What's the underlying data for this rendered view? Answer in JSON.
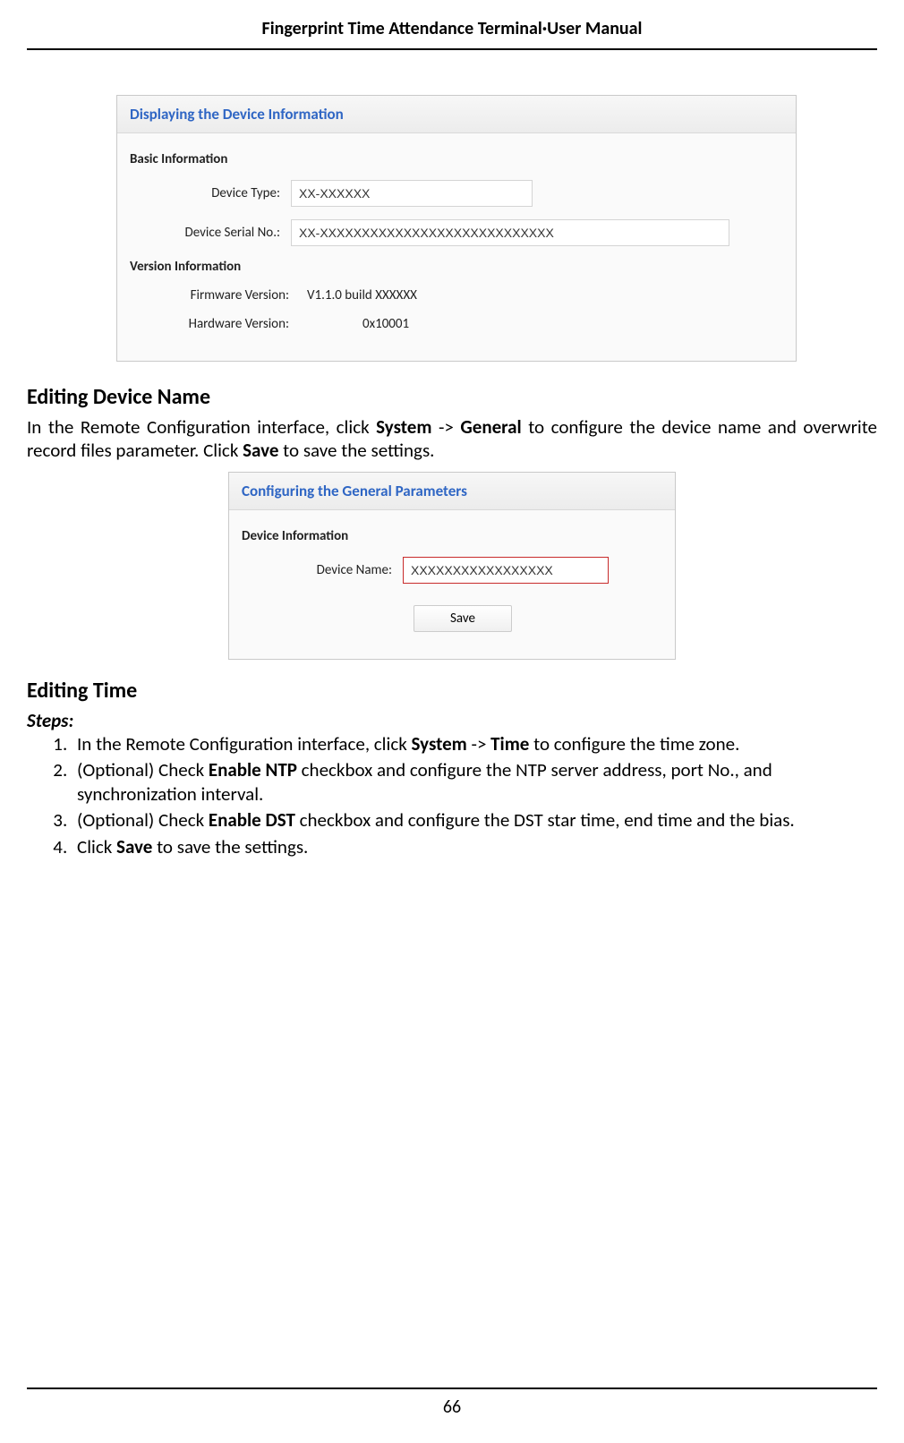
{
  "header": {
    "title": "Fingerprint Time Attendance Terminal·User Manual"
  },
  "page_number": "66",
  "panel1": {
    "title": "Displaying the Device Information",
    "section_basic": "Basic Information",
    "device_type_label": "Device Type:",
    "device_type_value": "XX-XXXXXX",
    "device_serial_label": "Device Serial No.:",
    "device_serial_value": "XX-XXXXXXXXXXXXXXXXXXXXXXXXXXXX",
    "section_version": "Version Information",
    "firmware_label": "Firmware Version:",
    "firmware_value": "V1.1.0 build  XXXXXX",
    "hardware_label": "Hardware Version:",
    "hardware_value": "0x10001"
  },
  "section_edit_name": {
    "heading": "Editing Device Name",
    "para_pre": "In the Remote Configuration interface, click ",
    "para_b1": "System",
    "para_mid1": " -> ",
    "para_b2": "General",
    "para_mid2": " to configure the device name and overwrite record files parameter. Click ",
    "para_b3": "Save",
    "para_post": " to save the settings."
  },
  "panel2": {
    "title": "Configuring the General Parameters",
    "section_device": "Device Information",
    "device_name_label": "Device Name:",
    "device_name_value": "XXXXXXXXXXXXXXXXX",
    "save_label": "Save"
  },
  "section_edit_time": {
    "heading": "Editing Time",
    "steps_label": "Steps:",
    "step1_pre": "In the Remote Configuration interface, click ",
    "step1_b1": "System",
    "step1_mid": " -> ",
    "step1_b2": "Time",
    "step1_post": " to configure the time zone.",
    "step2_pre": "(Optional) Check ",
    "step2_b1": "Enable NTP",
    "step2_post": " checkbox and configure the NTP server address, port No., and synchronization interval.",
    "step3_pre": "(Optional) Check ",
    "step3_b1": "Enable DST",
    "step3_post": " checkbox and configure the DST star time, end time and the bias.",
    "step4_pre": "Click ",
    "step4_b1": "Save",
    "step4_post": " to save the settings."
  }
}
